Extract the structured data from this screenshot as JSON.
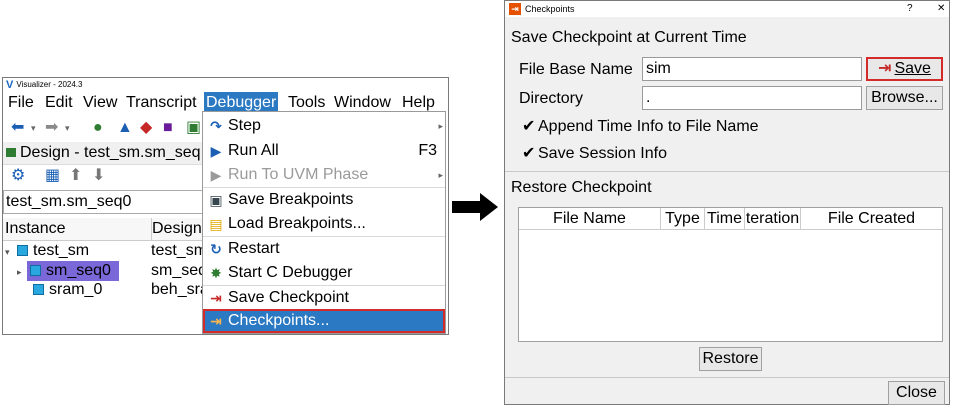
{
  "left_window": {
    "title": "Visualizer - 2024.3",
    "menus": [
      "File",
      "Edit",
      "View",
      "Transcript",
      "Debugger",
      "Tools",
      "Window",
      "Help"
    ],
    "active_menu": "Debugger",
    "design_panel_title": "Design - test_sm.sm_seq",
    "path_value": "test_sm.sm_seq0",
    "columns": [
      "Instance",
      "Design"
    ],
    "rows": [
      {
        "instance": "test_sm",
        "design": "test_sm"
      },
      {
        "instance": "sm_seq0",
        "design": "sm_seq"
      },
      {
        "instance": "sram_0",
        "design": "beh_sra"
      }
    ]
  },
  "debugger_menu": {
    "items": [
      {
        "label": "Step",
        "icon": "step-icon"
      },
      {
        "label": "Run All",
        "shortcut": "F3",
        "icon": "run-all-icon"
      },
      {
        "label": "Run To UVM Phase",
        "icon": "run-to-phase-icon"
      },
      {
        "label": "Save Breakpoints",
        "icon": "floppy-disk-icon"
      },
      {
        "label": "Load Breakpoints...",
        "icon": "folder-icon"
      },
      {
        "label": "Restart",
        "icon": "restart-icon"
      },
      {
        "label": "Start C Debugger",
        "icon": "bug-icon"
      },
      {
        "label": "Save Checkpoint",
        "icon": "save-checkpoint-icon"
      },
      {
        "label": "Checkpoints...",
        "icon": "checkpoint-icon"
      }
    ],
    "highlight_color": "#2b79c2",
    "outline_color": "#d32a2a"
  },
  "dialog": {
    "title": "Checkpoints",
    "help_label": "?",
    "close_label": "✕",
    "save_section_title": "Save Checkpoint at Current Time",
    "file_base_name_label": "File Base Name",
    "file_base_name_value": "sim",
    "save_button": "Save",
    "directory_label": "Directory",
    "directory_value": ".",
    "browse_button": "Browse...",
    "append_time_label": "Append Time Info to File Name",
    "save_session_label": "Save Session Info",
    "restore_section_title": "Restore Checkpoint",
    "table_columns": [
      "File Name",
      "Type",
      "Time",
      "teration",
      "File Created"
    ],
    "restore_button": "Restore",
    "close_button": "Close"
  }
}
